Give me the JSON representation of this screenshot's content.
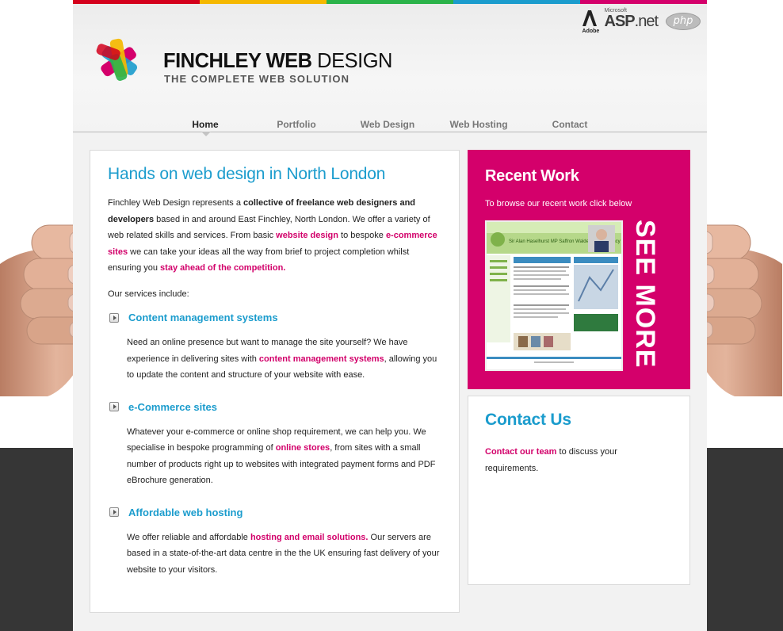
{
  "colors": {
    "accent_blue": "#1b9ccd",
    "accent_pink": "#d4006b",
    "bar": [
      "#d4001c",
      "#f5b800",
      "#2bb34a",
      "#1b9ccd",
      "#d4006b"
    ]
  },
  "tech_logos": {
    "adobe": "Adobe",
    "microsoft": "Microsoft",
    "asp": "ASP",
    "net": ".net",
    "php": "php"
  },
  "brand": {
    "name_bold": "FINCHLEY WEB",
    "name_light": " DESIGN",
    "tagline": "THE COMPLETE WEB SOLUTION"
  },
  "nav": {
    "items": [
      {
        "label": "Home"
      },
      {
        "label": "Portfolio"
      },
      {
        "label": "Web Design"
      },
      {
        "label": "Web Hosting"
      },
      {
        "label": "Contact"
      }
    ],
    "active": "Home"
  },
  "main": {
    "title": "Hands on web design in North London",
    "intro": {
      "t1": "Finchley Web Design represents a ",
      "b1": "collective of freelance web designers and developers",
      "t2": " based in and around East Finchley, North London. We offer a variety of web related skills and services. From basic ",
      "l1": "website design",
      "t3": " to bespoke ",
      "l2": "e-commerce sites",
      "t4": " we can take your ideas all the way from brief to project completion whilst ensuring you ",
      "l3": "stay ahead of the competition."
    },
    "services_label": "Our services include:",
    "services": [
      {
        "title": "Content management systems",
        "t1": "Need an online presence but want to manage the site yourself? We have experience in delivering sites with ",
        "link": "content management systems",
        "t2": ", allowing you to update the content and structure of your website with ease."
      },
      {
        "title": "e-Commerce sites",
        "t1": "Whatever your e-commerce or online shop requirement, we can help you. We specialise in bespoke programming of ",
        "link": "online stores",
        "t2": ", from sites with a small number of products right up to websites with integrated payment forms and PDF eBrochure generation."
      },
      {
        "title": "Affordable web hosting",
        "t1": "We offer reliable and affordable ",
        "link": "hosting and email solutions.",
        "t2": " Our servers are based in a state-of-the-art data centre in the the UK ensuring fast delivery of your website to your visitors."
      }
    ]
  },
  "recent_work": {
    "title": "Recent Work",
    "subtitle": "To browse our recent work click below",
    "see_more": "SEE MORE »",
    "thumb_heading": "Sir Alan Haselhurst MP Saffron Walden Constituency"
  },
  "contact": {
    "title": "Contact Us",
    "link": "Contact our team",
    "text": " to discuss your requirements."
  }
}
